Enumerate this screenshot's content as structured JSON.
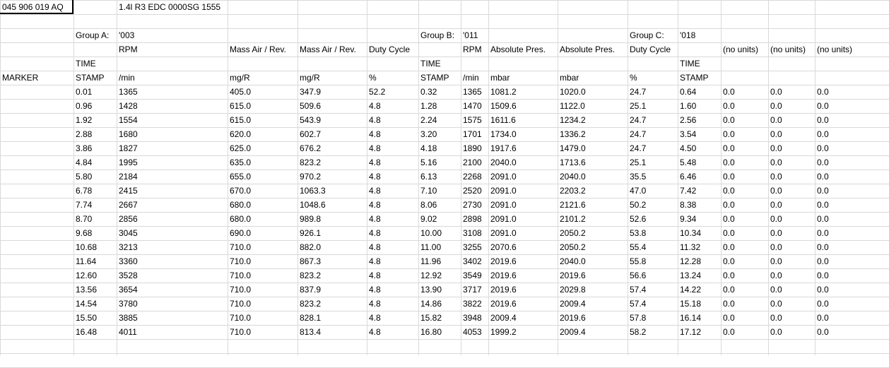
{
  "meta": {
    "part_number": "045 906 019 AQ",
    "engine_desc": "1.4l R3 EDC 0000SG  1555"
  },
  "groups": {
    "a": "Group A:",
    "a_code": "'003",
    "b": "Group B:",
    "b_code": "'011",
    "c": "Group C:",
    "c_code": "'018"
  },
  "header_names": [
    "RPM",
    "Mass Air / Rev.",
    "Mass Air / Rev.",
    "Duty Cycle",
    "RPM",
    "Absolute Pres.",
    "Absolute Pres.",
    "Duty Cycle",
    "(no units)",
    "(no units)",
    "(no units)"
  ],
  "time_label_1": "TIME",
  "time_label_2": "STAMP",
  "marker_label": "MARKER",
  "units": [
    "/min",
    "mg/R",
    "mg/R",
    "%",
    "/min",
    "mbar",
    "mbar",
    "%"
  ],
  "rows": [
    [
      "0.01",
      "1365",
      "405.0",
      "347.9",
      "52.2",
      "0.32",
      "1365",
      "1081.2",
      "1020.0",
      "24.7",
      "0.64",
      "0.0",
      "0.0",
      "0.0"
    ],
    [
      "0.96",
      "1428",
      "615.0",
      "509.6",
      "4.8",
      "1.28",
      "1470",
      "1509.6",
      "1122.0",
      "25.1",
      "1.60",
      "0.0",
      "0.0",
      "0.0"
    ],
    [
      "1.92",
      "1554",
      "615.0",
      "543.9",
      "4.8",
      "2.24",
      "1575",
      "1611.6",
      "1234.2",
      "24.7",
      "2.56",
      "0.0",
      "0.0",
      "0.0"
    ],
    [
      "2.88",
      "1680",
      "620.0",
      "602.7",
      "4.8",
      "3.20",
      "1701",
      "1734.0",
      "1336.2",
      "24.7",
      "3.54",
      "0.0",
      "0.0",
      "0.0"
    ],
    [
      "3.86",
      "1827",
      "625.0",
      "676.2",
      "4.8",
      "4.18",
      "1890",
      "1917.6",
      "1479.0",
      "24.7",
      "4.50",
      "0.0",
      "0.0",
      "0.0"
    ],
    [
      "4.84",
      "1995",
      "635.0",
      "823.2",
      "4.8",
      "5.16",
      "2100",
      "2040.0",
      "1713.6",
      "25.1",
      "5.48",
      "0.0",
      "0.0",
      "0.0"
    ],
    [
      "5.80",
      "2184",
      "655.0",
      "970.2",
      "4.8",
      "6.13",
      "2268",
      "2091.0",
      "2040.0",
      "35.5",
      "6.46",
      "0.0",
      "0.0",
      "0.0"
    ],
    [
      "6.78",
      "2415",
      "670.0",
      "1063.3",
      "4.8",
      "7.10",
      "2520",
      "2091.0",
      "2203.2",
      "47.0",
      "7.42",
      "0.0",
      "0.0",
      "0.0"
    ],
    [
      "7.74",
      "2667",
      "680.0",
      "1048.6",
      "4.8",
      "8.06",
      "2730",
      "2091.0",
      "2121.6",
      "50.2",
      "8.38",
      "0.0",
      "0.0",
      "0.0"
    ],
    [
      "8.70",
      "2856",
      "680.0",
      "989.8",
      "4.8",
      "9.02",
      "2898",
      "2091.0",
      "2101.2",
      "52.6",
      "9.34",
      "0.0",
      "0.0",
      "0.0"
    ],
    [
      "9.68",
      "3045",
      "690.0",
      "926.1",
      "4.8",
      "10.00",
      "3108",
      "2091.0",
      "2050.2",
      "53.8",
      "10.34",
      "0.0",
      "0.0",
      "0.0"
    ],
    [
      "10.68",
      "3213",
      "710.0",
      "882.0",
      "4.8",
      "11.00",
      "3255",
      "2070.6",
      "2050.2",
      "55.4",
      "11.32",
      "0.0",
      "0.0",
      "0.0"
    ],
    [
      "11.64",
      "3360",
      "710.0",
      "867.3",
      "4.8",
      "11.96",
      "3402",
      "2019.6",
      "2040.0",
      "55.8",
      "12.28",
      "0.0",
      "0.0",
      "0.0"
    ],
    [
      "12.60",
      "3528",
      "710.0",
      "823.2",
      "4.8",
      "12.92",
      "3549",
      "2019.6",
      "2019.6",
      "56.6",
      "13.24",
      "0.0",
      "0.0",
      "0.0"
    ],
    [
      "13.56",
      "3654",
      "710.0",
      "837.9",
      "4.8",
      "13.90",
      "3717",
      "2019.6",
      "2029.8",
      "57.4",
      "14.22",
      "0.0",
      "0.0",
      "0.0"
    ],
    [
      "14.54",
      "3780",
      "710.0",
      "823.2",
      "4.8",
      "14.86",
      "3822",
      "2019.6",
      "2009.4",
      "57.4",
      "15.18",
      "0.0",
      "0.0",
      "0.0"
    ],
    [
      "15.50",
      "3885",
      "710.0",
      "828.1",
      "4.8",
      "15.82",
      "3948",
      "2009.4",
      "2019.6",
      "57.8",
      "16.14",
      "0.0",
      "0.0",
      "0.0"
    ],
    [
      "16.48",
      "4011",
      "710.0",
      "813.4",
      "4.8",
      "16.80",
      "4053",
      "1999.2",
      "2009.4",
      "58.2",
      "17.12",
      "0.0",
      "0.0",
      "0.0"
    ]
  ]
}
